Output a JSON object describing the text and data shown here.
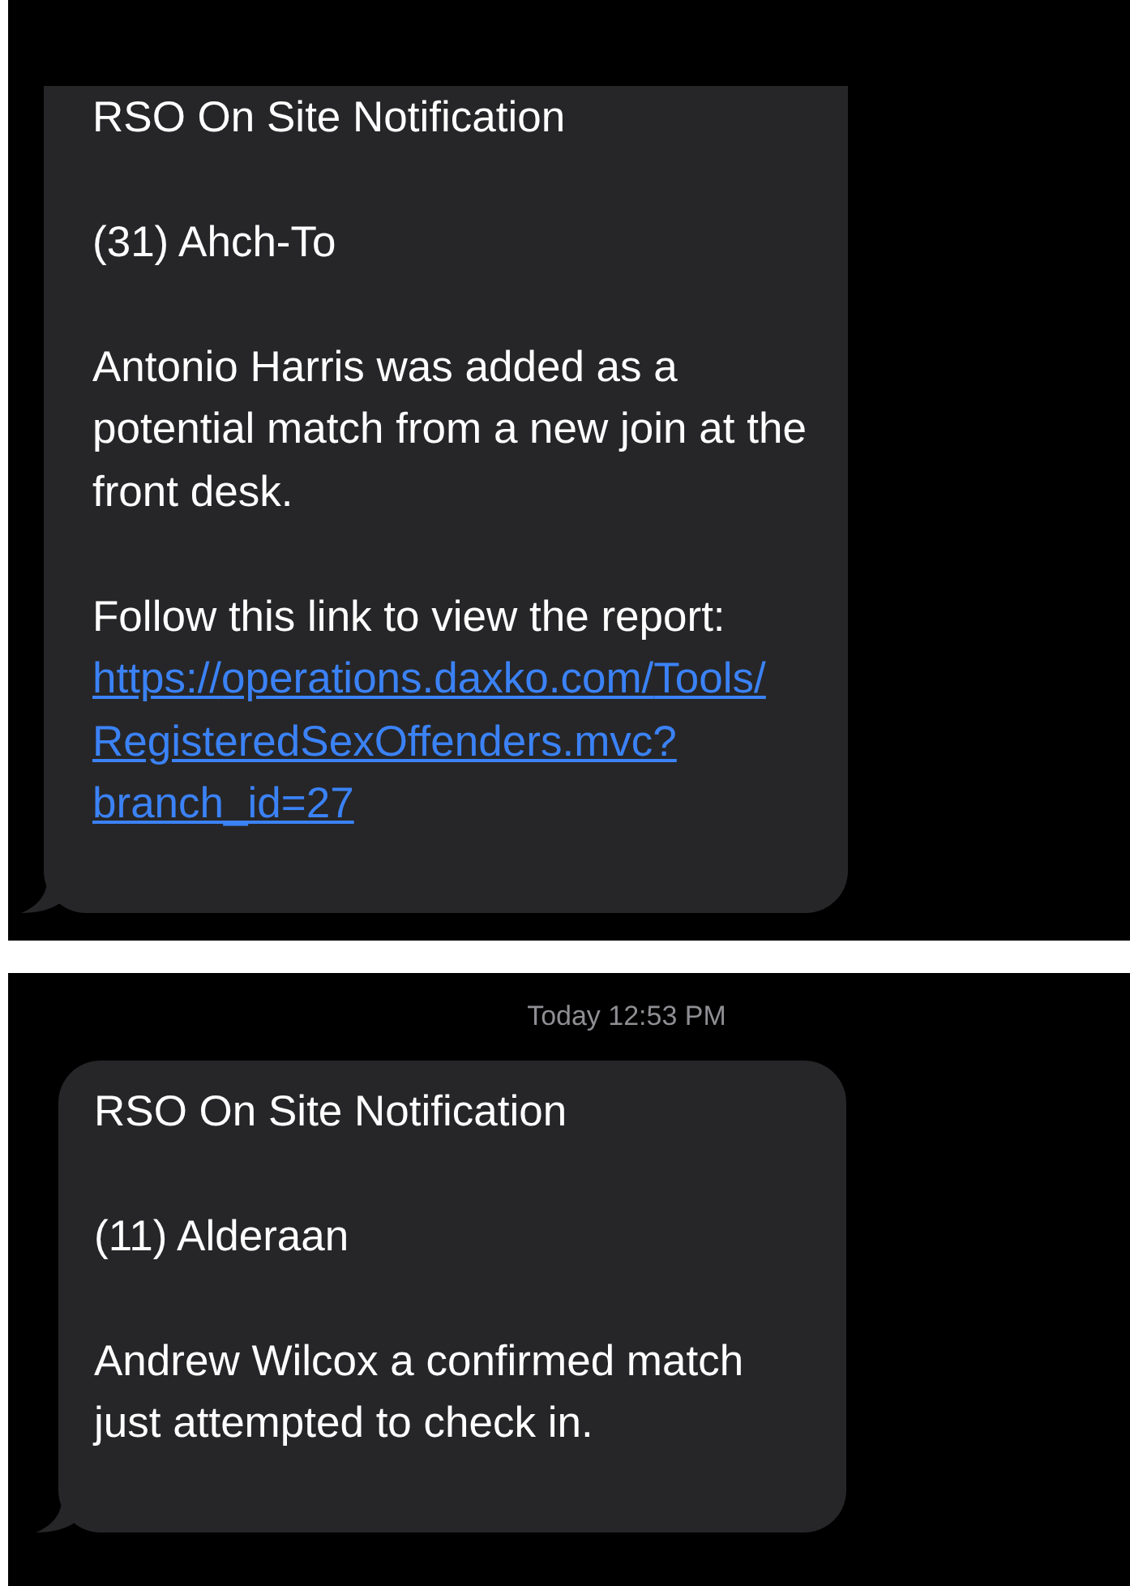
{
  "panels": [
    {
      "messages": [
        {
          "paragraphs": [
            {
              "text": "RSO On Site Notification"
            },
            {
              "text": "(31) Ahch-To"
            },
            {
              "text": "Antonio Harris was added as a potential match from a new join at the front desk."
            },
            {
              "text": "Follow this link to view the report:",
              "link": "https://operations.daxko.com/Tools/RegisteredSexOffenders.mvc?branch_id=27"
            }
          ]
        }
      ]
    },
    {
      "timestamp": "Today 12:53 PM",
      "messages": [
        {
          "paragraphs": [
            {
              "text": "RSO On Site Notification"
            },
            {
              "text": "(11) Alderaan"
            },
            {
              "text": "Andrew Wilcox a confirmed match just attempted to check in."
            }
          ]
        }
      ]
    }
  ]
}
